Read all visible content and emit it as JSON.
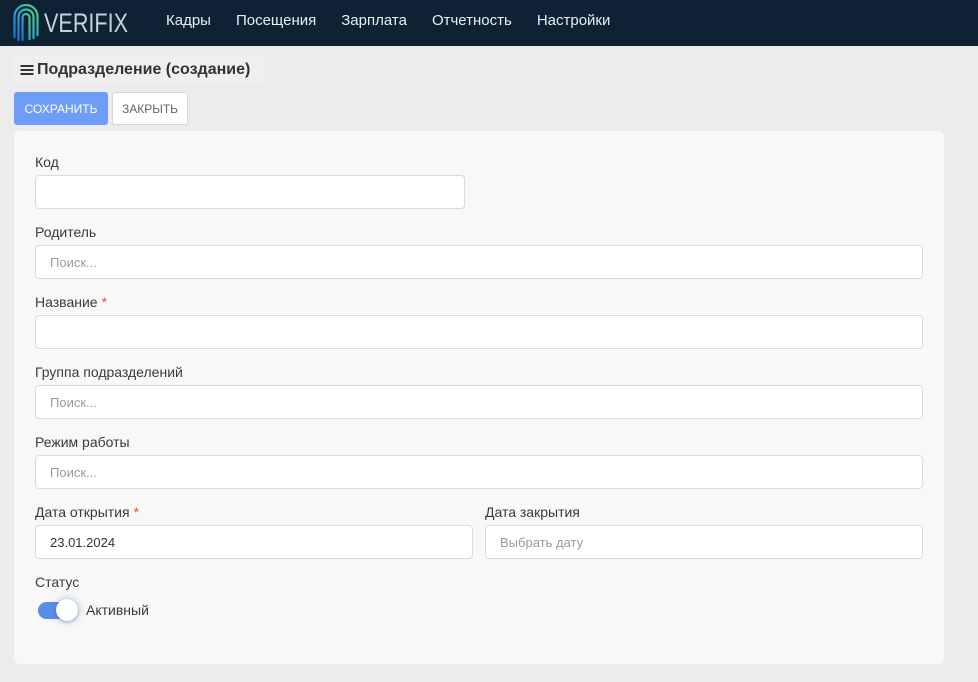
{
  "app": {
    "logo_text": "VERIFIX"
  },
  "nav": {
    "items": [
      {
        "label": "Кадры"
      },
      {
        "label": "Посещения"
      },
      {
        "label": "Зарплата"
      },
      {
        "label": "Отчетность"
      },
      {
        "label": "Настройки"
      }
    ]
  },
  "page": {
    "title": "Подразделение (создание)"
  },
  "toolbar": {
    "save_label": "СОХРАНИТЬ",
    "close_label": "ЗАКРЫТЬ"
  },
  "form": {
    "code": {
      "label": "Код"
    },
    "parent": {
      "label": "Родитель",
      "placeholder": "Поиск..."
    },
    "name": {
      "label": "Название",
      "required_mark": "*"
    },
    "division_group": {
      "label": "Группа подразделений",
      "placeholder": "Поиск..."
    },
    "work_schedule": {
      "label": "Режим работы",
      "placeholder": "Поиск..."
    },
    "open_date": {
      "label": "Дата открытия",
      "required_mark": "*",
      "value": "23.01.2024"
    },
    "close_date": {
      "label": "Дата закрытия",
      "placeholder": "Выбрать дату"
    },
    "status": {
      "label": "Статус",
      "state_label": "Активный",
      "active": true
    }
  },
  "icons": {
    "logo": "fingerprint-icon",
    "menu": "hamburger-menu-icon"
  },
  "colors": {
    "header_bg": "#0e2233",
    "page_bg": "#ececec",
    "card_bg": "#f8f8f8",
    "primary": "#6d9df7",
    "toggle_on": "#5b8de6",
    "required": "#e5533c"
  }
}
